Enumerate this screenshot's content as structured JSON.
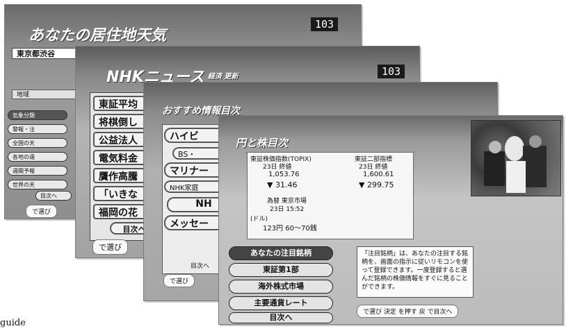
{
  "screens": {
    "weather": {
      "title": "あなたの居住地天気",
      "channel": "103",
      "location": "東京都渋谷",
      "sub": "地域",
      "items": [
        "気象分類",
        "警報・注",
        "全国の天",
        "各地の週",
        "週間予報",
        "世界の天",
        "目次へ"
      ],
      "hint": "で選び"
    },
    "news": {
      "title": "NHKニュース",
      "subtitle": "経済 更新",
      "channel": "103",
      "items": [
        "東証平均",
        "将棋倒し",
        "公益法人",
        "電気料金",
        "贋作高騰",
        "「いきな",
        "福岡の花",
        "目次へ"
      ],
      "hint": "で選び"
    },
    "recommend": {
      "title": "おすすめ情報目次",
      "items": [
        "ハイビ",
        "BS・",
        "マリナー",
        "NHK家庭",
        "NH",
        "メッセー"
      ],
      "footer": "目次へ",
      "hint": "で選び"
    },
    "stocks": {
      "title": "円と株目次",
      "nikkei": {
        "label": "東証株価指数(TOPIX)",
        "date": "23日 終値",
        "value": "1,053.76",
        "change": "▼ 31.46"
      },
      "tse": {
        "label": "東証二部指標",
        "date": "23日 終値",
        "value": "1,600.61",
        "change": "▼ 299.75"
      },
      "fx": {
        "label": "為替 東京市場",
        "time": "23日 15:52",
        "pair": "(ドル)",
        "rate": "123円 60～70銭"
      },
      "buttons": [
        "あなたの注目銘柄",
        "東証第1部",
        "海外株式市場",
        "主要通貨レート",
        "目次へ"
      ],
      "description": "「注目銘柄」は、あなたの注目する銘柄を、画面の指示に従いリモコンを使って登録できます。一度登録すると選んだ銘柄の株価情報をすぐに見ることができます。",
      "hint": "で選び 決定 を押す 戻 で目次へ"
    }
  },
  "caption": "guide"
}
